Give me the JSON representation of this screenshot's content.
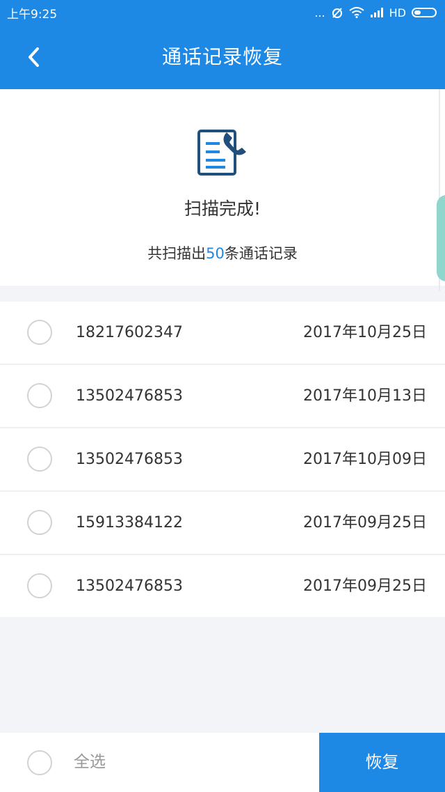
{
  "status_bar": {
    "time": "上午9:25",
    "dots": "...",
    "network": "HD"
  },
  "header": {
    "title": "通话记录恢复",
    "back_icon": "chevron-left-icon"
  },
  "summary": {
    "icon": "call-log-document-icon",
    "title": "扫描完成!",
    "count_prefix": "共扫描出",
    "count": "50",
    "count_suffix": "条通话记录"
  },
  "records": [
    {
      "phone": "18217602347",
      "date": "2017年10月25日"
    },
    {
      "phone": "13502476853",
      "date": "2017年10月13日"
    },
    {
      "phone": "13502476853",
      "date": "2017年10月09日"
    },
    {
      "phone": "15913384122",
      "date": "2017年09月25日"
    },
    {
      "phone": "13502476853",
      "date": "2017年09月25日"
    }
  ],
  "footer": {
    "select_all_label": "全选",
    "restore_label": "恢复"
  },
  "colors": {
    "primary": "#1e88e5",
    "background": "#f2f4f7",
    "text": "#333333",
    "muted_text": "#999999"
  }
}
